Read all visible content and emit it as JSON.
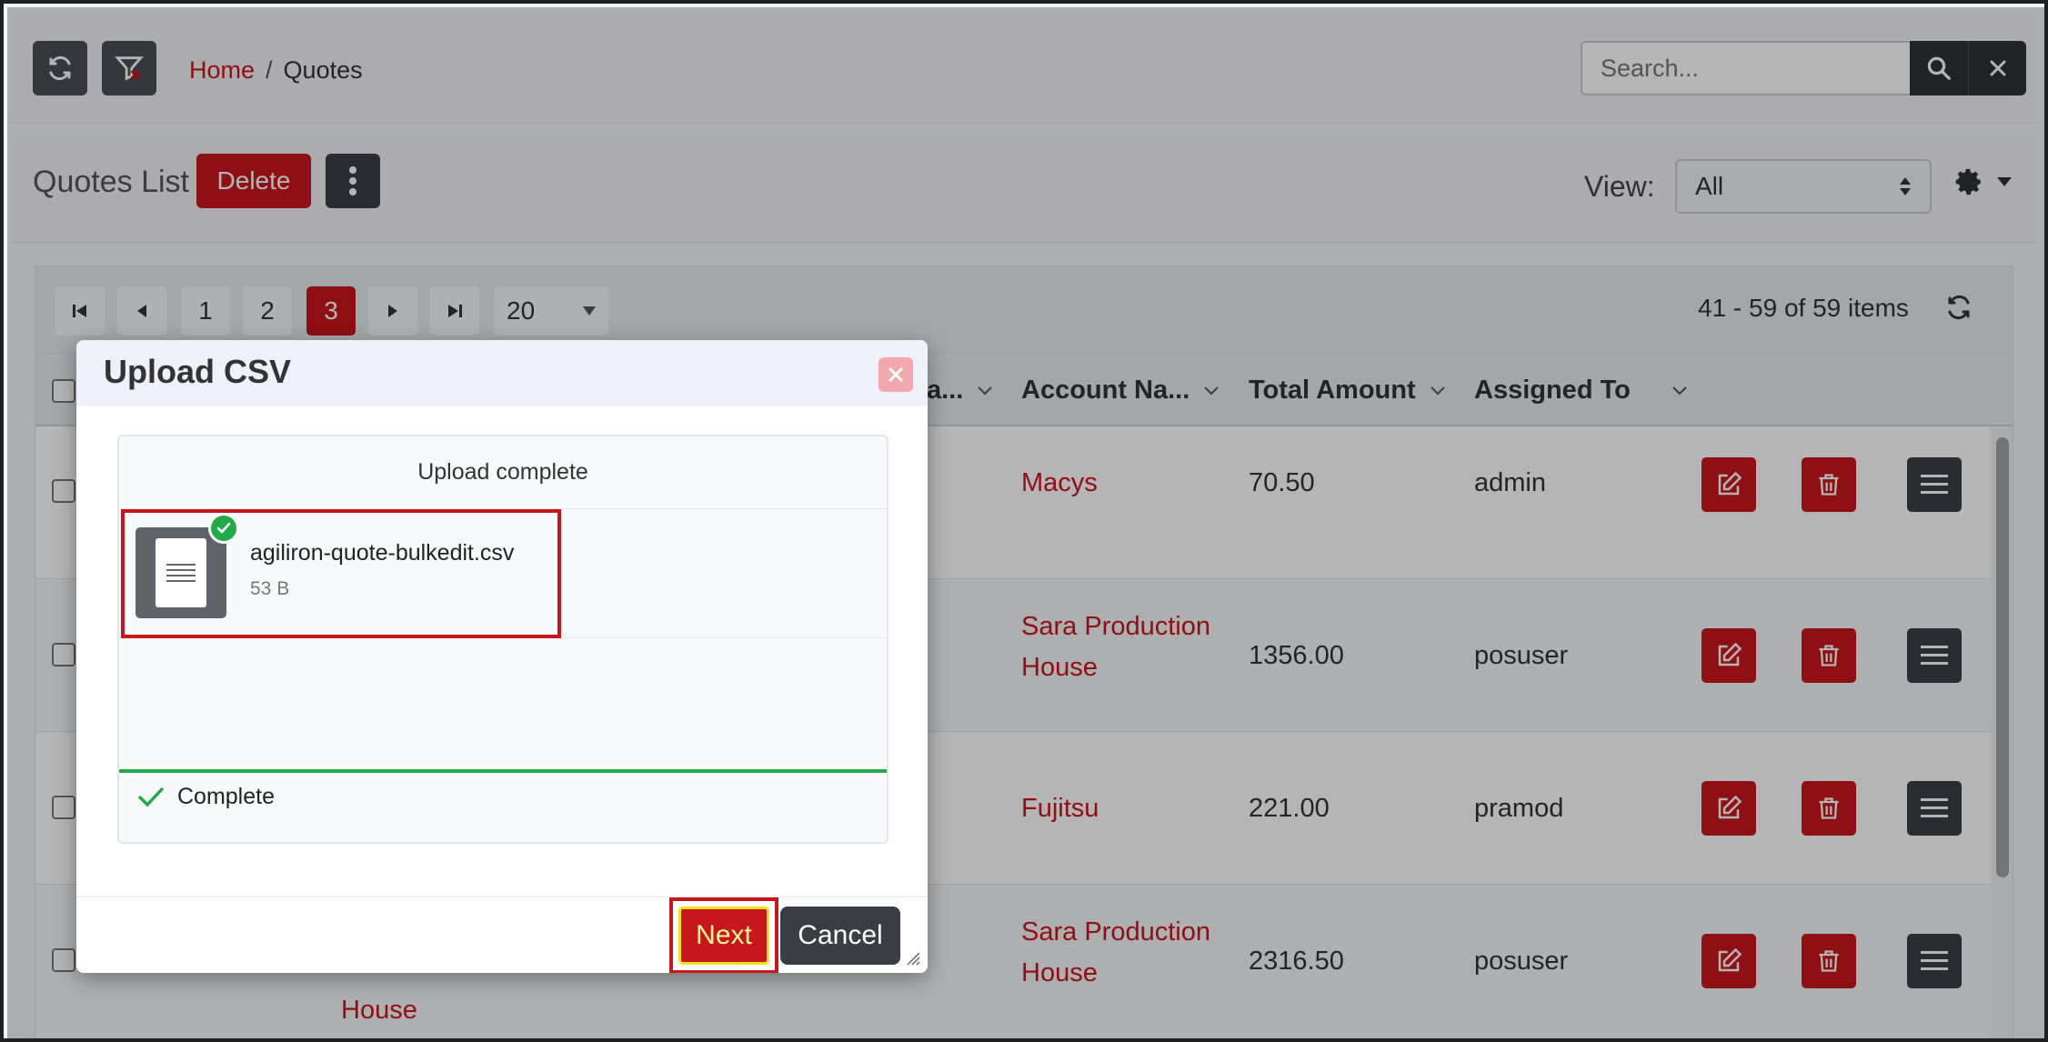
{
  "topbar": {
    "refresh_icon": "refresh-icon",
    "filter_icon": "filter-clear-icon",
    "breadcrumb": {
      "home": "Home",
      "separator": "/",
      "current": "Quotes"
    },
    "search": {
      "placeholder": "Search...",
      "value": ""
    }
  },
  "list": {
    "title": "Quotes List",
    "delete_label": "Delete",
    "view_label": "View:",
    "view_value": "All"
  },
  "pager": {
    "pages": [
      "1",
      "2",
      "3"
    ],
    "active_page": "3",
    "page_size": "20",
    "info": "41 - 59 of 59 items"
  },
  "columns": {
    "truncated": "a...",
    "account": "Account Na...",
    "total": "Total Amount",
    "assigned": "Assigned To"
  },
  "rows": [
    {
      "account_line1": "Macys",
      "account_line2": "",
      "total": "70.50",
      "assigned": "admin"
    },
    {
      "account_line1": "Sara Production",
      "account_line2": "House",
      "total": "1356.00",
      "assigned": "posuser"
    },
    {
      "account_line1": "Fujitsu",
      "account_line2": "",
      "total": "221.00",
      "assigned": "pramod"
    },
    {
      "account_line1": "Sara Production",
      "account_line2": "House",
      "total": "2316.50",
      "assigned": "posuser"
    }
  ],
  "background_fragment": "House",
  "modal": {
    "title": "Upload CSV",
    "status": "Upload complete",
    "file_name": "agiliron-quote-bulkedit.csv",
    "file_size": "53 B",
    "complete_label": "Complete",
    "next_label": "Next",
    "cancel_label": "Cancel"
  },
  "colors": {
    "accent": "#c8161d",
    "dark": "#3a3e44",
    "success": "#22a948",
    "highlight": "#f0e11c"
  }
}
